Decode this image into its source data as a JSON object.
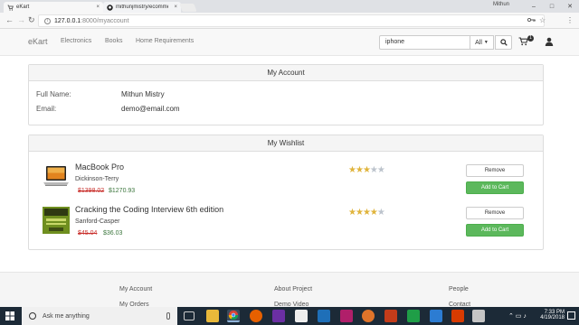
{
  "browser": {
    "tabs": [
      {
        "title": "eKart",
        "close": "×",
        "icon": "ekart-favicon"
      },
      {
        "title": "mithunjmistry/ecommerce",
        "close": "×",
        "icon": "github-icon"
      }
    ],
    "profile_name": "Mithun",
    "window_controls": [
      "–",
      "□",
      "✕"
    ],
    "url_host": "127.0.0.1",
    "url_path": ":8000/myaccount"
  },
  "navbar": {
    "brand": "eKart",
    "links": [
      "Electronics",
      "Books",
      "Home Requirements"
    ],
    "search_value": "iphone",
    "category": "All",
    "cart_count": "1"
  },
  "account": {
    "heading": "My Account",
    "full_name_label": "Full Name:",
    "full_name": "Mithun Mistry",
    "email_label": "Email:",
    "email": "demo@email.com"
  },
  "wishlist": {
    "heading": "My Wishlist",
    "remove_label": "Remove",
    "add_label": "Add to Cart",
    "items": [
      {
        "title": "MacBook Pro",
        "seller": "Dickinson-Terry",
        "old_price": "$1398.02",
        "price": "$1270.93",
        "rating": 3,
        "max_rating": 5
      },
      {
        "title": "Cracking the Coding Interview 6th edition",
        "seller": "Sanford-Casper",
        "old_price": "$45.04",
        "price": "$36.03",
        "rating": 4,
        "max_rating": 5
      }
    ]
  },
  "footer": {
    "col1": [
      "My Account",
      "My Orders"
    ],
    "col2": [
      "About Project",
      "Demo Video"
    ],
    "col3": [
      "People",
      "Contact"
    ]
  },
  "taskbar": {
    "search_placeholder": "Ask me anything",
    "time": "7:33 PM",
    "date": "4/19/2018"
  },
  "colors": {
    "star": "#e0b43c",
    "add_to_cart": "#5cb85c",
    "old_price": "#c9302c",
    "new_price": "#3c763d"
  }
}
